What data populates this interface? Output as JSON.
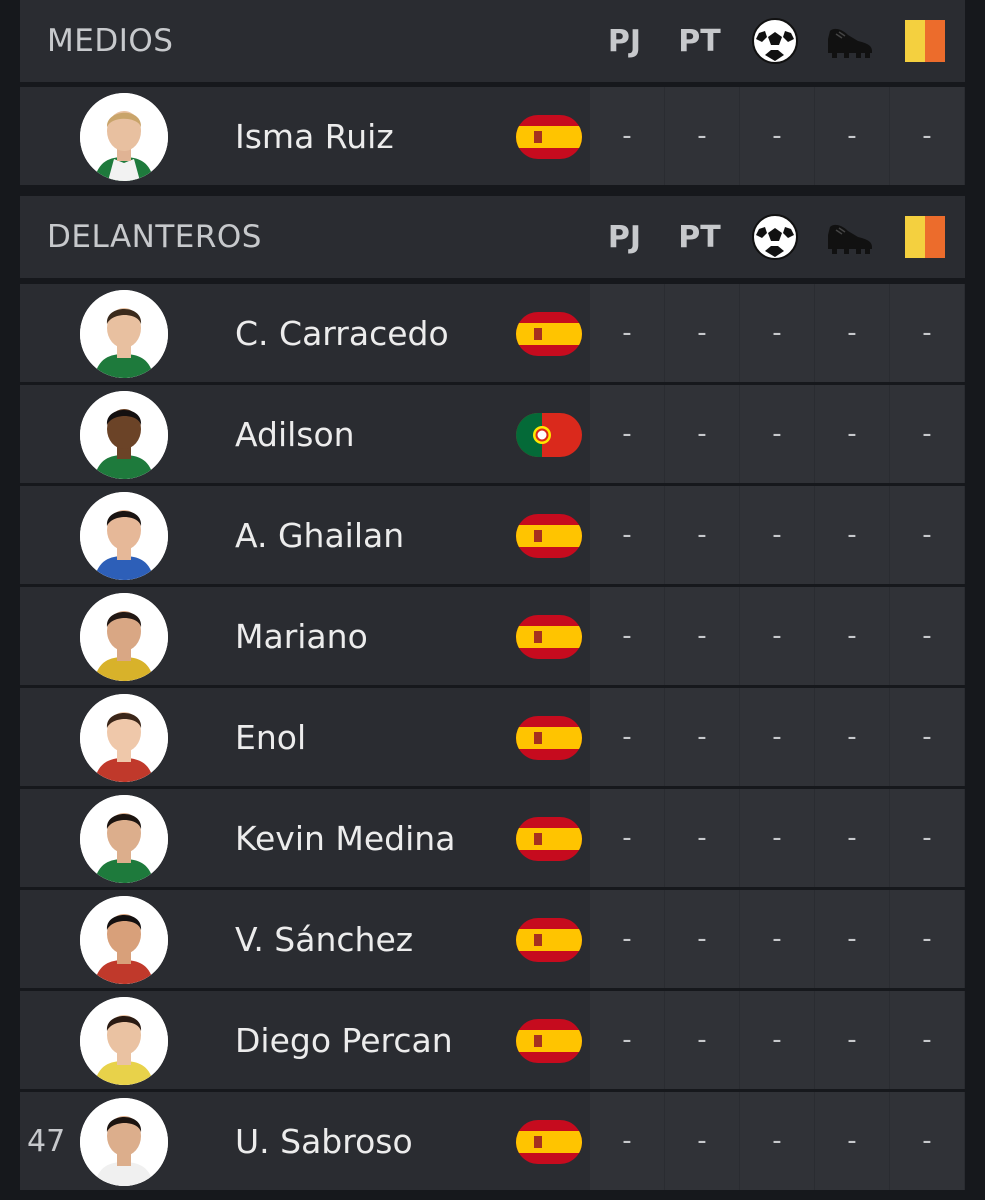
{
  "sections": [
    {
      "title": "MEDIOS",
      "columns": [
        "PJ",
        "PT"
      ],
      "icons": [
        "soccer-ball-icon",
        "football-boot-icon",
        "yellow-red-card-icon"
      ],
      "players": [
        {
          "number": "",
          "name": "Isma Ruiz",
          "flag": "spain-flag-icon",
          "stats": [
            "-",
            "-",
            "-",
            "-",
            "-"
          ]
        }
      ]
    },
    {
      "title": "DELANTEROS",
      "columns": [
        "PJ",
        "PT"
      ],
      "icons": [
        "soccer-ball-icon",
        "football-boot-icon",
        "yellow-red-card-icon"
      ],
      "players": [
        {
          "number": "",
          "name": "C. Carracedo",
          "flag": "spain-flag-icon",
          "stats": [
            "-",
            "-",
            "-",
            "-",
            "-"
          ]
        },
        {
          "number": "",
          "name": "Adilson",
          "flag": "portugal-flag-icon",
          "stats": [
            "-",
            "-",
            "-",
            "-",
            "-"
          ]
        },
        {
          "number": "",
          "name": "A. Ghailan",
          "flag": "spain-flag-icon",
          "stats": [
            "-",
            "-",
            "-",
            "-",
            "-"
          ]
        },
        {
          "number": "",
          "name": "Mariano",
          "flag": "spain-flag-icon",
          "stats": [
            "-",
            "-",
            "-",
            "-",
            "-"
          ]
        },
        {
          "number": "",
          "name": "Enol",
          "flag": "spain-flag-icon",
          "stats": [
            "-",
            "-",
            "-",
            "-",
            "-"
          ]
        },
        {
          "number": "",
          "name": "Kevin Medina",
          "flag": "spain-flag-icon",
          "stats": [
            "-",
            "-",
            "-",
            "-",
            "-"
          ]
        },
        {
          "number": "",
          "name": "V. Sánchez",
          "flag": "spain-flag-icon",
          "stats": [
            "-",
            "-",
            "-",
            "-",
            "-"
          ]
        },
        {
          "number": "",
          "name": "Diego Percan",
          "flag": "spain-flag-icon",
          "stats": [
            "-",
            "-",
            "-",
            "-",
            "-"
          ]
        },
        {
          "number": "47",
          "name": "U. Sabroso",
          "flag": "spain-flag-icon",
          "stats": [
            "-",
            "-",
            "-",
            "-",
            "-"
          ]
        }
      ]
    }
  ],
  "colors": {
    "background": "#16181c",
    "row": "#2a2c31",
    "cell": "#303237",
    "text": "#ececec",
    "yellow_card": "#f4d03f",
    "red_card": "#ec6c2c"
  }
}
